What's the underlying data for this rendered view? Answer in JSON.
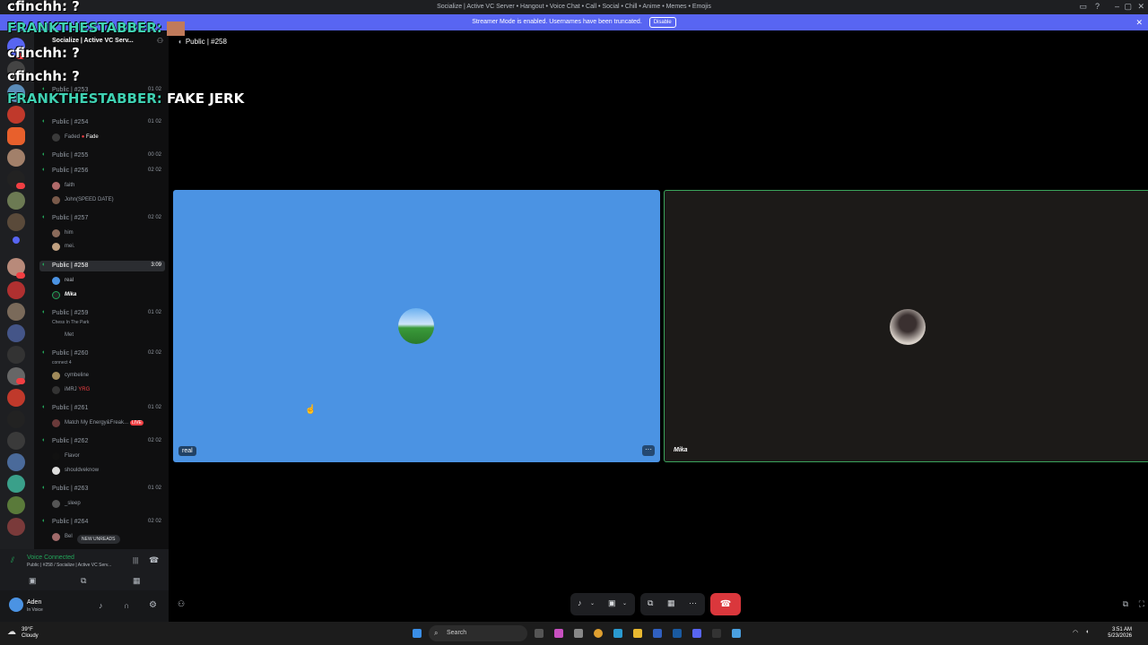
{
  "window": {
    "title": "Socialize | Active VC Server • Hangout • Voice Chat • Call • Social • Chill • Anime • Memes • Emojis"
  },
  "banner": {
    "text": "Streamer Mode is enabled. Usernames have been truncated.",
    "button": "Disable"
  },
  "server": {
    "name": "Socialize | Active VC Serv..."
  },
  "overlay_chat": [
    {
      "user": "cfinchh:",
      "msg": "?"
    },
    {
      "user": "FRANKTHESTABBER:",
      "msg": ""
    },
    {
      "user": "cfinchh:",
      "msg": "?"
    },
    {
      "user": "cfinchh:",
      "msg": "?"
    },
    {
      "user": "FRANKTHESTABBER:",
      "msg": "FAKE JERK"
    }
  ],
  "channels": [
    {
      "name": "Public | #253",
      "count": "01 02"
    },
    {
      "name": "Public | #254",
      "count": "01 02",
      "users": [
        "Faded"
      ],
      "user_tags": [
        "Fade"
      ]
    },
    {
      "name": "Public | #255",
      "count": "00 02"
    },
    {
      "name": "Public | #256",
      "count": "02 02",
      "users": [
        "faith",
        "John(SPEED DATE)"
      ]
    },
    {
      "name": "Public | #257",
      "count": "02 02",
      "users": [
        "him",
        "mei."
      ]
    },
    {
      "name": "Public | #258",
      "count": "3:09",
      "users": [
        "real",
        "Mika"
      ],
      "selected": true
    },
    {
      "name": "Public | #259",
      "count": "01 02",
      "sub": "Chess In The Park",
      "users": [
        "Met"
      ]
    },
    {
      "name": "Public | #260",
      "count": "02 02",
      "sub": "connect 4",
      "users": [
        "cymbeline",
        "iMRJ"
      ],
      "user_tags": [
        "YRG"
      ]
    },
    {
      "name": "Public | #261",
      "count": "01 02",
      "users": [
        "Match My Energy&Freak..."
      ],
      "live": "LIVE"
    },
    {
      "name": "Public | #262",
      "count": "02 02",
      "users": [
        "Flavor",
        "shouldveknow"
      ]
    },
    {
      "name": "Public | #263",
      "count": "01 02",
      "users": [
        "_sleep"
      ]
    },
    {
      "name": "Public | #264",
      "count": "02 02",
      "users": [
        "Bel"
      ]
    }
  ],
  "new_unreads": "NEW UNREADS",
  "voice": {
    "status": "Voice Connected",
    "detail": "Public | #258 / Socialize | Active VC Serv..."
  },
  "user": {
    "name": "Aden",
    "status": "In Voice"
  },
  "call": {
    "channel": "Public | #258",
    "tiles": [
      {
        "name": "real"
      },
      {
        "name": "Mika"
      }
    ]
  },
  "taskbar": {
    "search": "Search",
    "weather_temp": "39°F",
    "weather_desc": "Cloudy",
    "time": "3:51 AM",
    "date": "5/23/2026"
  },
  "colors": {
    "accent": "#5865f2",
    "online": "#23a55a",
    "danger": "#da373c",
    "tile_blue": "#4b93e3"
  }
}
